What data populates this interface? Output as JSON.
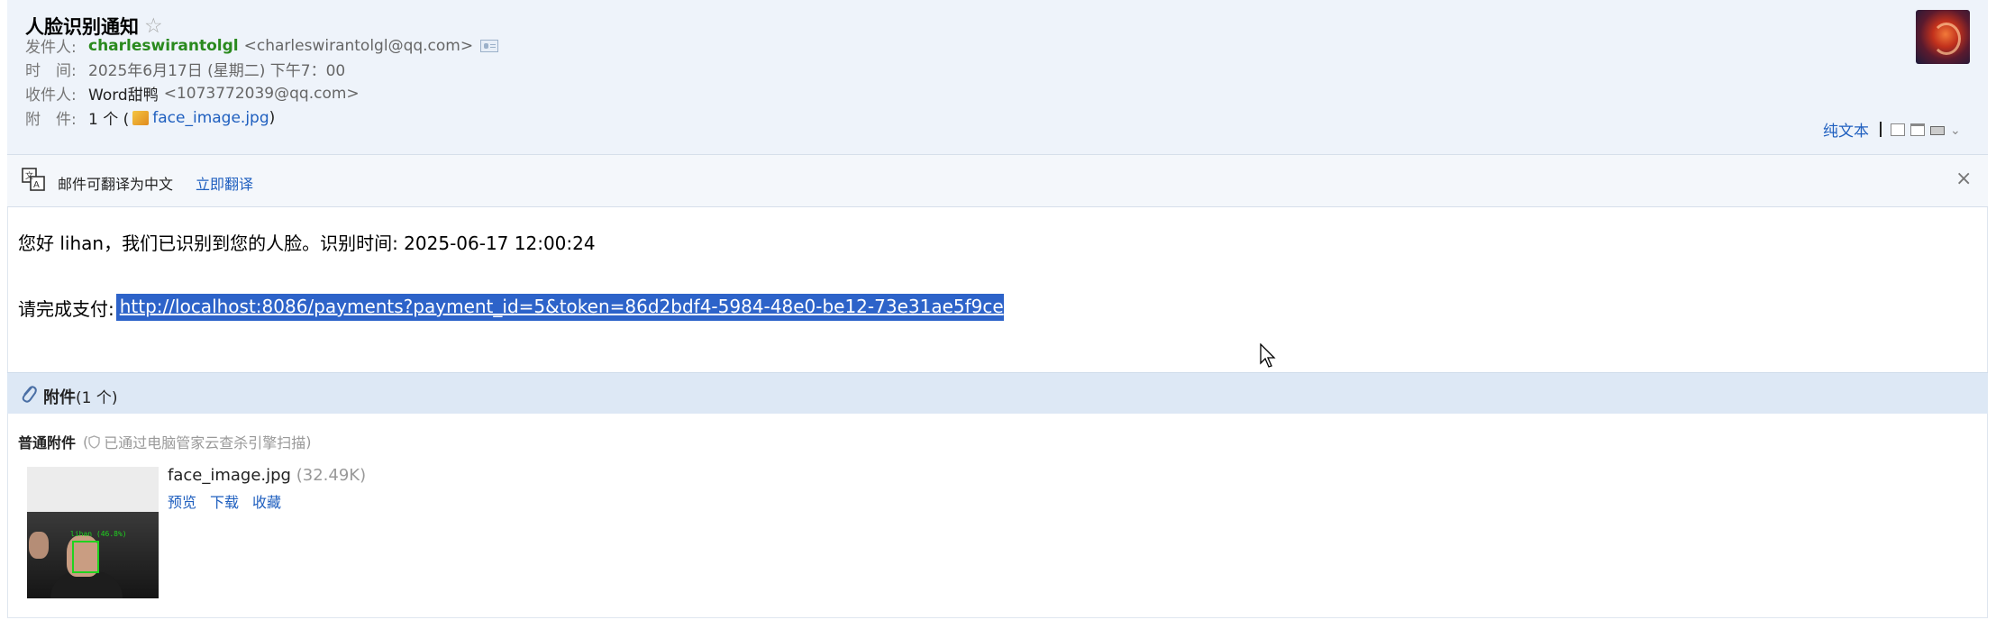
{
  "email": {
    "subject": "人脸识别通知",
    "sender_label": "发件人:",
    "sender_name": "charleswirantolgl",
    "sender_addr": "<charleswirantolgl@qq.com>",
    "time_label": "时　间:",
    "time_value": "2025年6月17日 (星期二) 下午7：00",
    "recipient_label": "收件人:",
    "recipient_name": "Word甜鸭",
    "recipient_addr": "<1073772039@qq.com>",
    "attachment_label": "附　件:",
    "attachment_count_prefix": "1 个 (",
    "attachment_filename": "face_image.jpg",
    "attachment_count_suffix": ")",
    "plain_text_label": "纯文本"
  },
  "translate": {
    "message": "邮件可翻译为中文",
    "action": "立即翻译"
  },
  "body": {
    "greeting": "您好 lihan，我们已识别到您的人脸。识别时间: 2025-06-17 12:00:24",
    "pay_prefix": "请完成支付:",
    "pay_link": "http://localhost:8086/payments?payment_id=5&token=86d2bdf4-5984-48e0-be12-73e31ae5f9ce"
  },
  "attachments": {
    "title": "附件",
    "count": "(1 个)",
    "section_label": "普通附件",
    "scan_note_open": "(",
    "scan_note": "已通过电脑管家云查杀引擎扫描",
    "scan_note_close": ")",
    "file": {
      "name": "face_image.jpg",
      "size": "(32.49K)",
      "thumb_label": "lihan (46.8%)",
      "actions": [
        "预览",
        "下载",
        "收藏"
      ]
    }
  },
  "icons": {
    "star": "star-icon",
    "contact": "contact-card-icon",
    "translate": "translate-icon",
    "close": "close-icon",
    "clip": "paperclip-icon",
    "shield": "shield-icon"
  },
  "colors": {
    "header_bg": "#eef3fa",
    "sender_green": "#2a8a1e",
    "link_blue": "#1f5fbf",
    "selection_blue": "#2d63c9",
    "attachment_bar": "#dde8f5"
  }
}
